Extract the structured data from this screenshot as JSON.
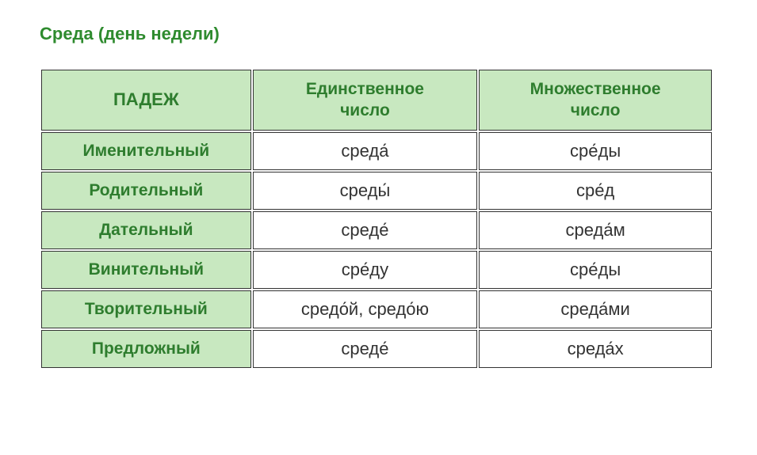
{
  "title": "Среда (день недели)",
  "headers": {
    "case": "ПАДЕЖ",
    "singular_line1": "Единственное",
    "singular_line2": "число",
    "plural_line1": "Множественное",
    "plural_line2": "число"
  },
  "rows": [
    {
      "case": "Именительный",
      "singular": "среда́",
      "plural": "сре́ды"
    },
    {
      "case": "Родительный",
      "singular": "среды́",
      "plural": "сре́д"
    },
    {
      "case": "Дательный",
      "singular": "среде́",
      "plural": "среда́м"
    },
    {
      "case": "Винительный",
      "singular": "сре́ду",
      "plural": "сре́ды"
    },
    {
      "case": "Творительный",
      "singular": "средо́й, средо́ю",
      "plural": "среда́ми"
    },
    {
      "case": "Предложный",
      "singular": "среде́",
      "plural": "среда́х"
    }
  ]
}
